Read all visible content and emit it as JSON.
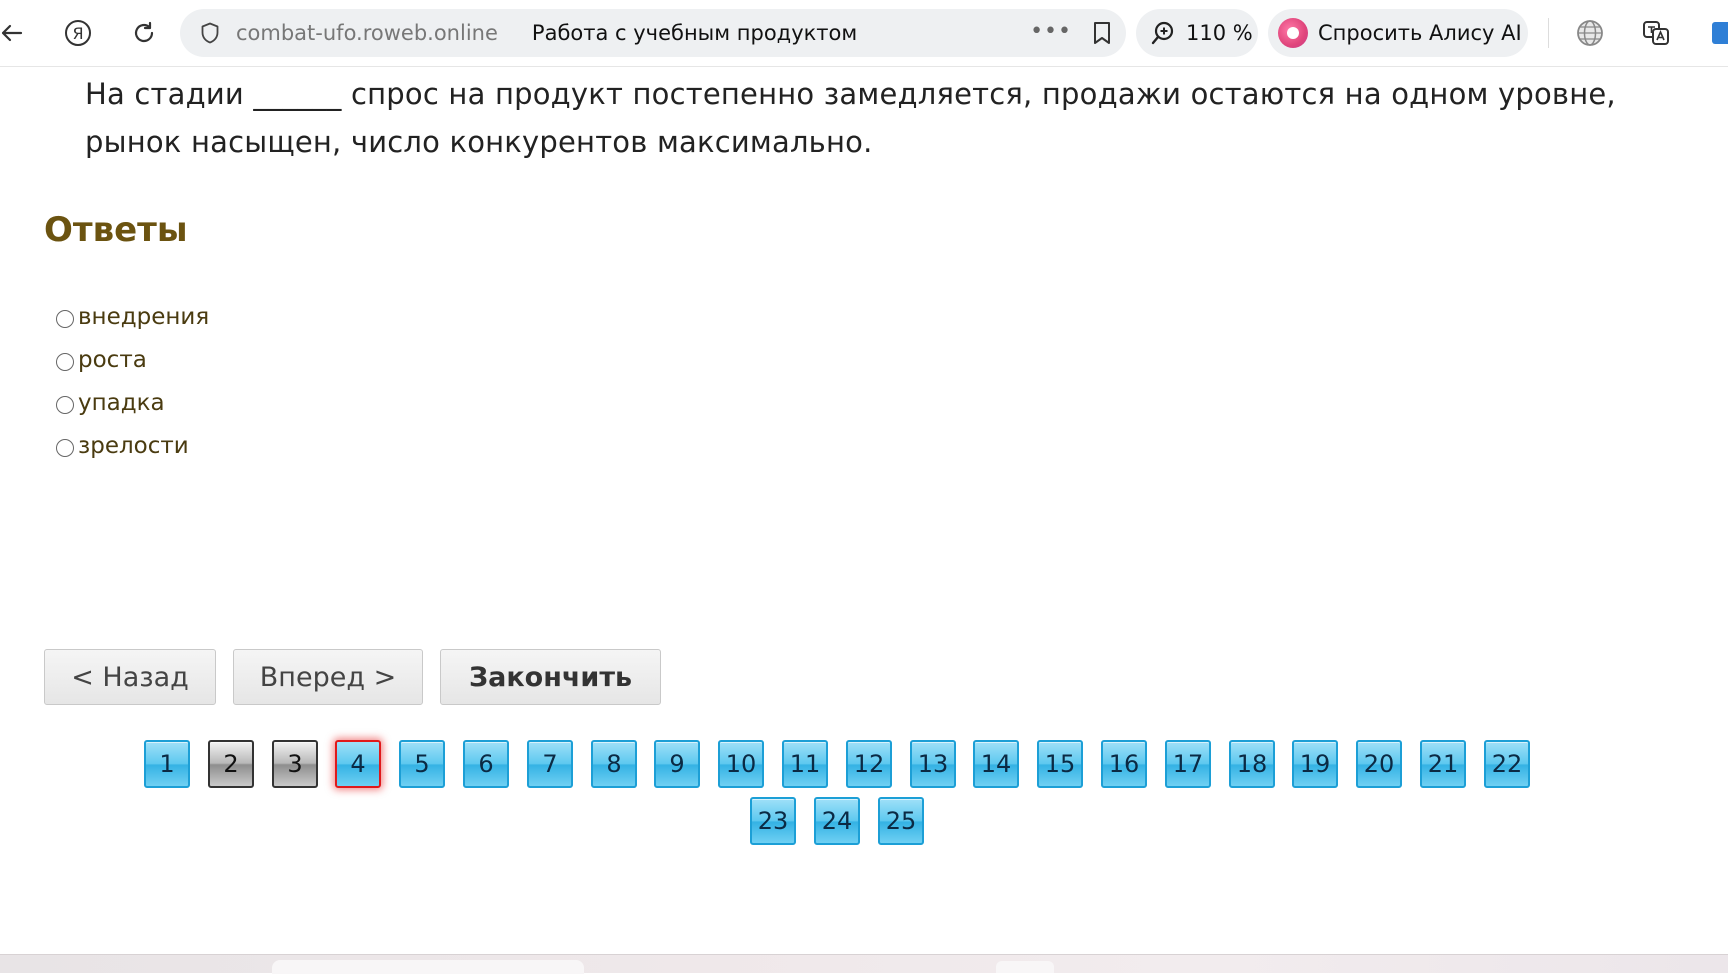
{
  "browser": {
    "domain": "combat-ufo.roweb.online",
    "page_title": "Работа с учебным продуктом",
    "zoom": "110 %",
    "alice_label": "Спросить Алису AI",
    "more_icon": "more-dots-icon",
    "bookmark_icon": "bookmark-icon"
  },
  "question": {
    "text": "На стадии ______ спрос на продукт постепенно замедляется, продажи остаются на одном уровне, рынок насыщен, число конкурентов максимально."
  },
  "answers": {
    "heading": "Ответы",
    "options": [
      {
        "label": "внедрения"
      },
      {
        "label": "роста"
      },
      {
        "label": "упадка"
      },
      {
        "label": "зрелости"
      }
    ]
  },
  "nav": {
    "back": "< Назад",
    "forward": "Вперед >",
    "finish": "Закончить"
  },
  "pagination": {
    "pages": [
      "1",
      "2",
      "3",
      "4",
      "5",
      "6",
      "7",
      "8",
      "9",
      "10",
      "11",
      "12",
      "13",
      "14",
      "15",
      "16",
      "17",
      "18",
      "19",
      "20",
      "21",
      "22",
      "23",
      "24",
      "25"
    ],
    "answered": [
      "2",
      "3"
    ],
    "current": "4"
  },
  "colors": {
    "heading": "#6b5310",
    "page_button": "#5cc8ef",
    "page_answered": "#8e8e8e",
    "page_current_border": "#e0191b"
  }
}
